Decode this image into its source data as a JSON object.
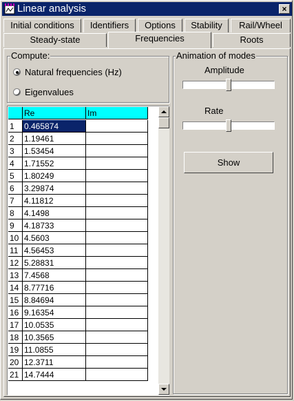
{
  "window": {
    "title": "Linear analysis",
    "close_label": "×"
  },
  "tabs": {
    "row1": [
      "Initial conditions",
      "Identifiers",
      "Options",
      "Stability",
      "Rail/Wheel"
    ],
    "row2": [
      "Steady-state",
      "Frequencies",
      "Roots"
    ],
    "active": "Frequencies"
  },
  "compute": {
    "label": "Compute:",
    "options": [
      "Natural frequencies (Hz)",
      "Eigenvalues"
    ],
    "selected": "Natural frequencies (Hz)"
  },
  "grid": {
    "columns": [
      "Re",
      "Im"
    ],
    "selected_row": 1,
    "rows": [
      {
        "n": "1",
        "re": "0.465874",
        "im": ""
      },
      {
        "n": "2",
        "re": "1.19461",
        "im": ""
      },
      {
        "n": "3",
        "re": "1.53454",
        "im": ""
      },
      {
        "n": "4",
        "re": "1.71552",
        "im": ""
      },
      {
        "n": "5",
        "re": "1.80249",
        "im": ""
      },
      {
        "n": "6",
        "re": "3.29874",
        "im": ""
      },
      {
        "n": "7",
        "re": "4.11812",
        "im": ""
      },
      {
        "n": "8",
        "re": "4.1498",
        "im": ""
      },
      {
        "n": "9",
        "re": "4.18733",
        "im": ""
      },
      {
        "n": "10",
        "re": "4.5603",
        "im": ""
      },
      {
        "n": "11",
        "re": "4.56453",
        "im": ""
      },
      {
        "n": "12",
        "re": "5.28831",
        "im": ""
      },
      {
        "n": "13",
        "re": "7.4568",
        "im": ""
      },
      {
        "n": "14",
        "re": "8.77716",
        "im": ""
      },
      {
        "n": "15",
        "re": "8.84694",
        "im": ""
      },
      {
        "n": "16",
        "re": "9.16354",
        "im": ""
      },
      {
        "n": "17",
        "re": "10.0535",
        "im": ""
      },
      {
        "n": "18",
        "re": "10.3565",
        "im": ""
      },
      {
        "n": "19",
        "re": "11.0855",
        "im": ""
      },
      {
        "n": "20",
        "re": "12.3711",
        "im": ""
      },
      {
        "n": "21",
        "re": "14.7444",
        "im": ""
      }
    ]
  },
  "animation": {
    "label": "Animation of modes",
    "amplitude_label": "Amplitude",
    "amplitude_value": 0.5,
    "rate_label": "Rate",
    "rate_value": 0.5,
    "show_label": "Show"
  },
  "icons": {
    "title_icon": "app-icon",
    "scroll_up": "arrow-up-icon",
    "scroll_down": "arrow-down-icon"
  }
}
